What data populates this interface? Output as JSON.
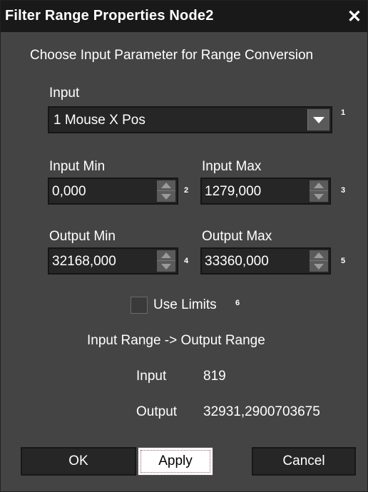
{
  "window": {
    "title": "Filter Range Properties Node2",
    "close_glyph": "✕"
  },
  "header_text": "Choose Input Parameter for Range Conversion",
  "input": {
    "label": "Input",
    "selected": "1 Mouse X Pos",
    "marker": "1"
  },
  "input_min": {
    "label": "Input Min",
    "value": "0,000",
    "marker": "2"
  },
  "input_max": {
    "label": "Input Max",
    "value": "1279,000",
    "marker": "3"
  },
  "output_min": {
    "label": "Output Min",
    "value": "32168,000",
    "marker": "4"
  },
  "output_max": {
    "label": "Output Max",
    "value": "33360,000",
    "marker": "5"
  },
  "use_limits": {
    "label": "Use Limits",
    "checked": false,
    "marker": "6"
  },
  "range_heading": "Input Range -> Output Range",
  "readout": {
    "input_label": "Input",
    "input_value": "819",
    "output_label": "Output",
    "output_value": "32931,2900703675"
  },
  "buttons": {
    "ok": "OK",
    "apply": "Apply",
    "cancel": "Cancel"
  },
  "colors": {
    "panel": "#444444",
    "titlebar": "#191919",
    "field": "#262626"
  }
}
